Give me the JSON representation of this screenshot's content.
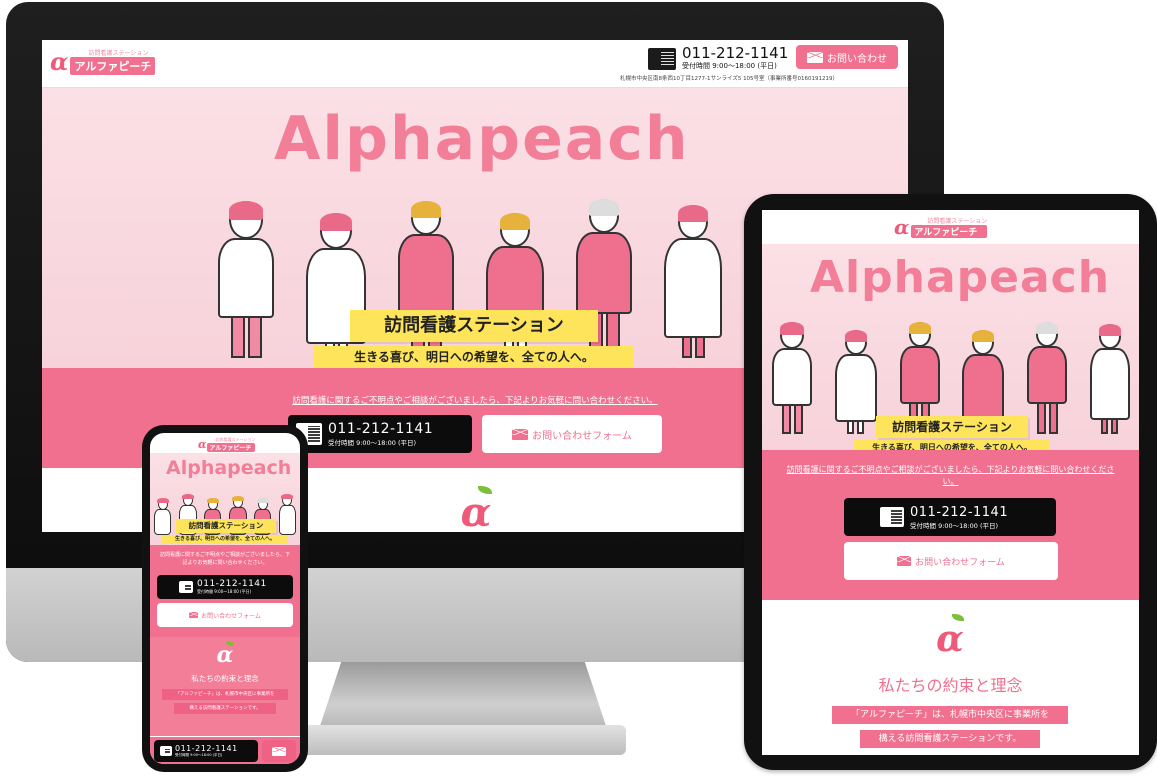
{
  "site": {
    "logo_sub": "訪問看護ステーション",
    "logo_name": "アルファピーチ",
    "logo_mark": "α",
    "hero_title": "Alphapeach",
    "badge_main": "訪問看護ステーション",
    "badge_sub": "生きる喜び、明日への希望を、全ての人へ。",
    "intro": "訪問看護に関するご不明点やご相談がございましたら、下記よりお気軽に問い合わせください。",
    "tel": "011-212-1141",
    "hours": "受付時間 9:00〜18:00 (平日)",
    "contact_label": "お問い合わせ",
    "form_label": "お問い合わせフォーム",
    "address": "札幌市中央区南8条西10丁目1277-1サンライズ5 105号室（事業所番号0160191219）",
    "section_title": "私たちの約束と理念",
    "promise_line1": "「アルファピーチ」は、札幌市中央区に事業所を",
    "promise_line2": "構える訪問看護ステーションです。"
  },
  "phone_view": {
    "intro": "訪問看護に関するご不明点やご相談がございましたら、下記よりお気軽に問い合わせください。",
    "promise_line1": "「アルファピーチ」は、札幌市中央区に事業所を",
    "promise_line2": "構える訪問看護ステーションです。"
  },
  "icons": [
    "phone-icon",
    "mail-icon",
    "apple-logo-icon"
  ],
  "colors": {
    "brand_pink": "#f2708f",
    "hero_bg": "#fbe0e6",
    "badge_yellow": "#fde45a",
    "tel_black": "#0c0c0c",
    "leaf_green": "#7cbf3b"
  }
}
